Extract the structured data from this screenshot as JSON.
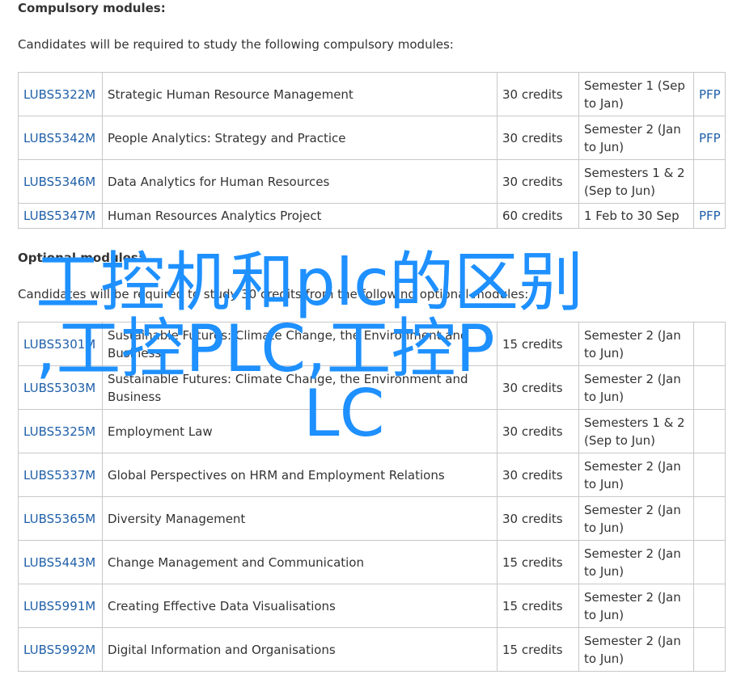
{
  "compulsory": {
    "heading": "Compulsory modules:",
    "intro": "Candidates will be required to study the following compulsory modules:",
    "rows": [
      {
        "code": "LUBS5322M",
        "title": "Strategic Human Resource Management",
        "credits": "30 credits",
        "semester": "Semester 1 (Sep to Jan)",
        "pfp": "PFP"
      },
      {
        "code": "LUBS5342M",
        "title": "People Analytics: Strategy and Practice",
        "credits": "30 credits",
        "semester": "Semester 2 (Jan to Jun)",
        "pfp": "PFP"
      },
      {
        "code": "LUBS5346M",
        "title": "Data Analytics for Human Resources",
        "credits": "30 credits",
        "semester": "Semesters 1 & 2 (Sep to Jun)",
        "pfp": ""
      },
      {
        "code": "LUBS5347M",
        "title": "Human Resources Analytics Project",
        "credits": "60 credits",
        "semester": "1 Feb to 30 Sep",
        "pfp": "PFP"
      }
    ]
  },
  "optional": {
    "heading": "Optional modules:",
    "intro": "Candidates will be required to study 30 credits from the following optional modules:",
    "rows": [
      {
        "code": "LUBS5301M",
        "title": "Sustainable Futures: Climate Change, the Environment and Business",
        "credits": "15 credits",
        "semester": "Semester 2 (Jan to Jun)",
        "pfp": ""
      },
      {
        "code": "LUBS5303M",
        "title": "Sustainable Futures: Climate Change, the Environment and Business",
        "credits": "30 credits",
        "semester": "Semester 2 (Jan to Jun)",
        "pfp": ""
      },
      {
        "code": "LUBS5325M",
        "title": "Employment Law",
        "credits": "30 credits",
        "semester": "Semesters 1 & 2 (Sep to Jun)",
        "pfp": ""
      },
      {
        "code": "LUBS5337M",
        "title": "Global Perspectives on HRM and Employment Relations",
        "credits": "30 credits",
        "semester": "Semester 2 (Jan to Jun)",
        "pfp": ""
      },
      {
        "code": "LUBS5365M",
        "title": "Diversity Management",
        "credits": "30 credits",
        "semester": "Semester 2 (Jan to Jun)",
        "pfp": ""
      },
      {
        "code": "LUBS5443M",
        "title": "Change Management and Communication",
        "credits": "15 credits",
        "semester": "Semester 2 (Jan to Jun)",
        "pfp": ""
      },
      {
        "code": "LUBS5991M",
        "title": "Creating Effective Data Visualisations",
        "credits": "15 credits",
        "semester": "Semester 2 (Jan to Jun)",
        "pfp": ""
      },
      {
        "code": "LUBS5992M",
        "title": "Digital Information and Organisations",
        "credits": "15 credits",
        "semester": "Semester 2 (Jan to Jun)",
        "pfp": ""
      }
    ]
  },
  "overlay": {
    "line1": "工控机和plc的区别",
    "line2": ",工控PLC,工控P",
    "line3": "LC"
  },
  "colors": {
    "link": "#1f5fa8",
    "overlay": "#1e90ff",
    "border": "#c8c8c8"
  }
}
